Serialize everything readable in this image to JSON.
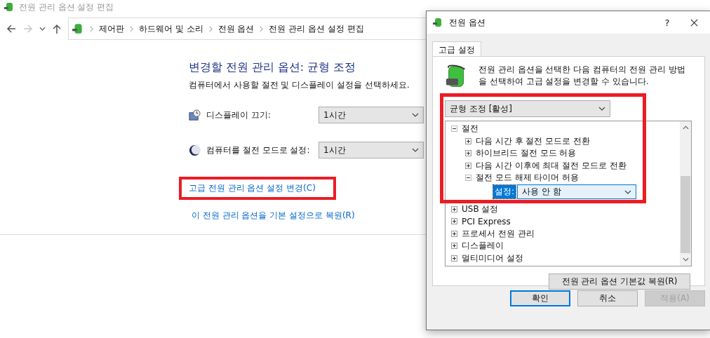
{
  "window": {
    "title": "전원 관리 옵션 설정 편집"
  },
  "nav_buttons": [
    {
      "kind": "back",
      "disabled": false
    },
    {
      "kind": "forward",
      "disabled": true
    },
    {
      "kind": "recent",
      "disabled": false
    },
    {
      "kind": "up",
      "disabled": false
    }
  ],
  "breadcrumb": [
    "제어판",
    "하드웨어 및 소리",
    "전원 옵션",
    "전원 관리 옵션 설정 편집"
  ],
  "heading": "변경할 전원 관리 옵션: 균형 조정",
  "description": "컴퓨터에서 사용할 절전 및 디스플레이 설정을 선택하세요.",
  "settings": [
    {
      "kind": "display",
      "label": "디스플레이 끄기:",
      "value": "1시간"
    },
    {
      "kind": "sleep",
      "label": "컴퓨터를 절전 모드로 설정:",
      "value": "1시간"
    }
  ],
  "links": [
    {
      "text": "고급 전원 관리 옵션 설정 변경(C)",
      "highlighted": true
    },
    {
      "text": "이 전원 관리 옵션을 기본 설정으로 복원(R)",
      "highlighted": false
    }
  ],
  "dialog": {
    "title": "전원 옵션",
    "help": "?",
    "tabs": [
      {
        "label": "고급 설정",
        "selected": true
      }
    ],
    "intro": "전원 관리 옵션을 선택한 다음 컴퓨터의 전원 관리 방법을 선택하여 고급 설정을 변경할 수 있습니다.",
    "plan": "균형 조정 [활성]",
    "highlighted": true,
    "tree": [
      {
        "label": "절전",
        "expanded": true,
        "children": [
          {
            "label": "다음 시간 후 절전 모드로 전환",
            "expanded": false
          },
          {
            "label": "하이브리드 절전 모드 허용",
            "expanded": false
          },
          {
            "label": "다음 시간 이후에 최대 절전 모드로 전환",
            "expanded": false
          },
          {
            "label": "절전 모드 해제 타이머 허용",
            "expanded": true,
            "setting": {
              "label": "설정:",
              "value": "사용 안 함"
            }
          }
        ]
      },
      {
        "label": "USB 설정",
        "expanded": false
      },
      {
        "label": "PCI Express",
        "expanded": false
      },
      {
        "label": "프로세서 전원 관리",
        "expanded": false
      },
      {
        "label": "디스플레이",
        "expanded": false
      },
      {
        "label": "멀티미디어 설정",
        "expanded": false
      }
    ],
    "restore_button": "전원 관리 옵션 기본값 복원(R)",
    "buttons": [
      {
        "label": "확인",
        "default": true,
        "disabled": false
      },
      {
        "label": "취소",
        "default": false,
        "disabled": false
      },
      {
        "label": "적용(A)",
        "default": false,
        "disabled": true
      }
    ]
  }
}
